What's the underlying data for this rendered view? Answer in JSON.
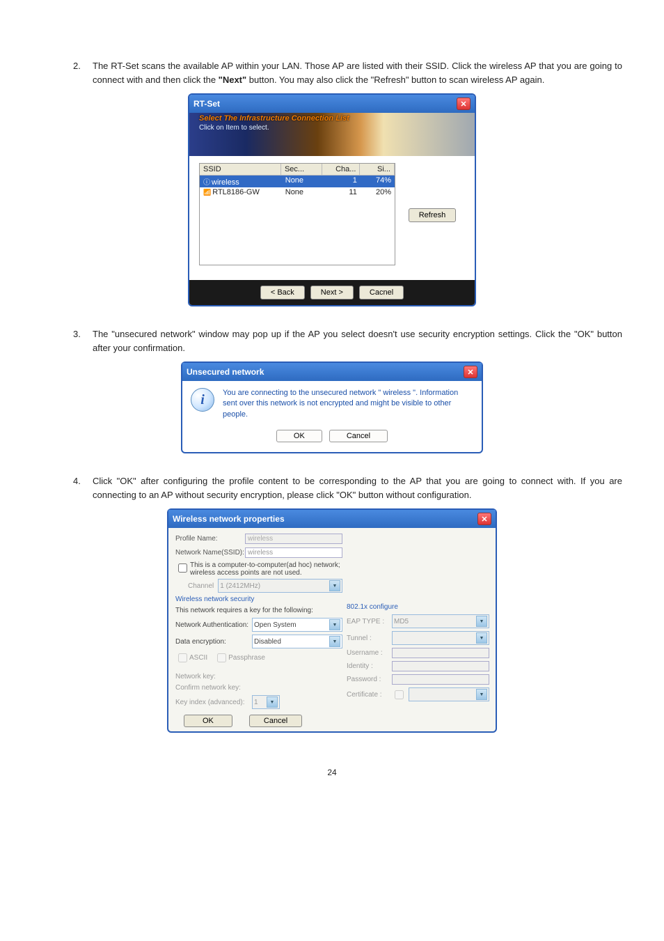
{
  "steps": {
    "s2_num": "2.",
    "s2_a": "The RT-Set scans the available AP within your LAN. Those AP are listed with their SSID. Click the wireless AP that you are going to connect with and then click the ",
    "s2_b": "\"Next\"",
    "s2_c": " button. You may also click the \"Refresh\" button to scan wireless AP again.",
    "s3_num": "3.",
    "s3_text": "The \"unsecured network\" window may pop up if the AP you select doesn't use security encryption settings. Click the \"OK\" button after your confirmation.",
    "s4_num": "4.",
    "s4_text": "Click \"OK\" after configuring the profile content to be corresponding to the AP that you are going to connect with. If you are connecting to an AP without security encryption, please click \"OK\" button without configuration."
  },
  "rtset": {
    "title": "RT-Set",
    "banner_title": "Select The Infrastructure Connection List",
    "banner_sub": "Click on Item to select.",
    "cols": {
      "ssid": "SSID",
      "sec": "Sec...",
      "cha": "Cha...",
      "si": "Si..."
    },
    "rows": [
      {
        "ssid": "wireless",
        "sec": "None",
        "cha": "1",
        "si": "74%",
        "selected": true
      },
      {
        "ssid": "RTL8186-GW",
        "sec": "None",
        "cha": "11",
        "si": "20%",
        "selected": false
      }
    ],
    "refresh": "Refresh",
    "back": "< Back",
    "next": "Next >",
    "cancel": "Cacnel"
  },
  "unsec": {
    "title": "Unsecured network",
    "msg": "You are connecting to the unsecured network \" wireless \". Information sent over this network is not encrypted and might be visible to other people.",
    "ok": "OK",
    "cancel": "Cancel"
  },
  "props": {
    "title": "Wireless network properties",
    "profile_name_label": "Profile Name:",
    "profile_name_value": "wireless",
    "ssid_label": "Network Name(SSID):",
    "ssid_value": "wireless",
    "adhoc_text": "This is a computer-to-computer(ad hoc) network; wireless access points are not used.",
    "channel_label": "Channel",
    "channel_value": "1 (2412MHz)",
    "sec_section": "Wireless network security",
    "sec_desc": "This network requires a key for the following:",
    "auth_label": "Network Authentication:",
    "auth_value": "Open System",
    "enc_label": "Data encryption:",
    "enc_value": "Disabled",
    "ascii": "ASCII",
    "pass": "Passphrase",
    "netkey": "Network key:",
    "confkey": "Confirm network key:",
    "keyidx": "Key index (advanced):",
    "keyidx_value": "1",
    "ok": "OK",
    "cancel": "Cancel",
    "cfg802": "802.1x configure",
    "eap_label": "EAP TYPE :",
    "eap_value": "MD5",
    "tunnel": "Tunnel :",
    "username": "Username :",
    "identity": "Identity :",
    "password": "Password :",
    "cert": "Certificate :"
  },
  "page_number": "24"
}
